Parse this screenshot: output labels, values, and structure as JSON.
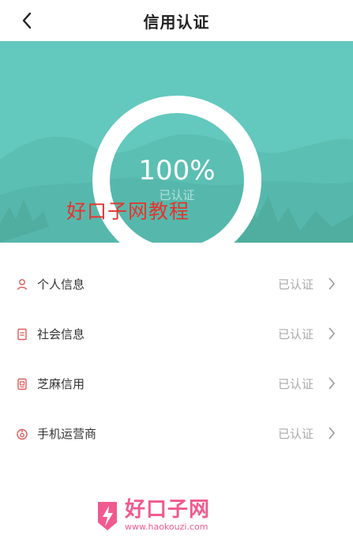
{
  "header": {
    "title": "信用认证"
  },
  "summary": {
    "percent": "100%",
    "status": "已认证",
    "progress": 1.0
  },
  "watermark": {
    "text": "好口子网教程"
  },
  "items": [
    {
      "label": "个人信息",
      "status": "已认证",
      "icon": "person-icon"
    },
    {
      "label": "社会信息",
      "status": "已认证",
      "icon": "document-icon"
    },
    {
      "label": "芝麻信用",
      "status": "已认证",
      "icon": "card-icon"
    },
    {
      "label": "手机运营商",
      "status": "已认证",
      "icon": "phone-carrier-icon"
    }
  ],
  "logo": {
    "name": "好口子网",
    "url": "www.haokouzi.com"
  },
  "colors": {
    "banner": "#63c8bd",
    "accent_icon": "#e05a5a",
    "watermark": "#e8322c",
    "logo": "#f05a8e"
  }
}
